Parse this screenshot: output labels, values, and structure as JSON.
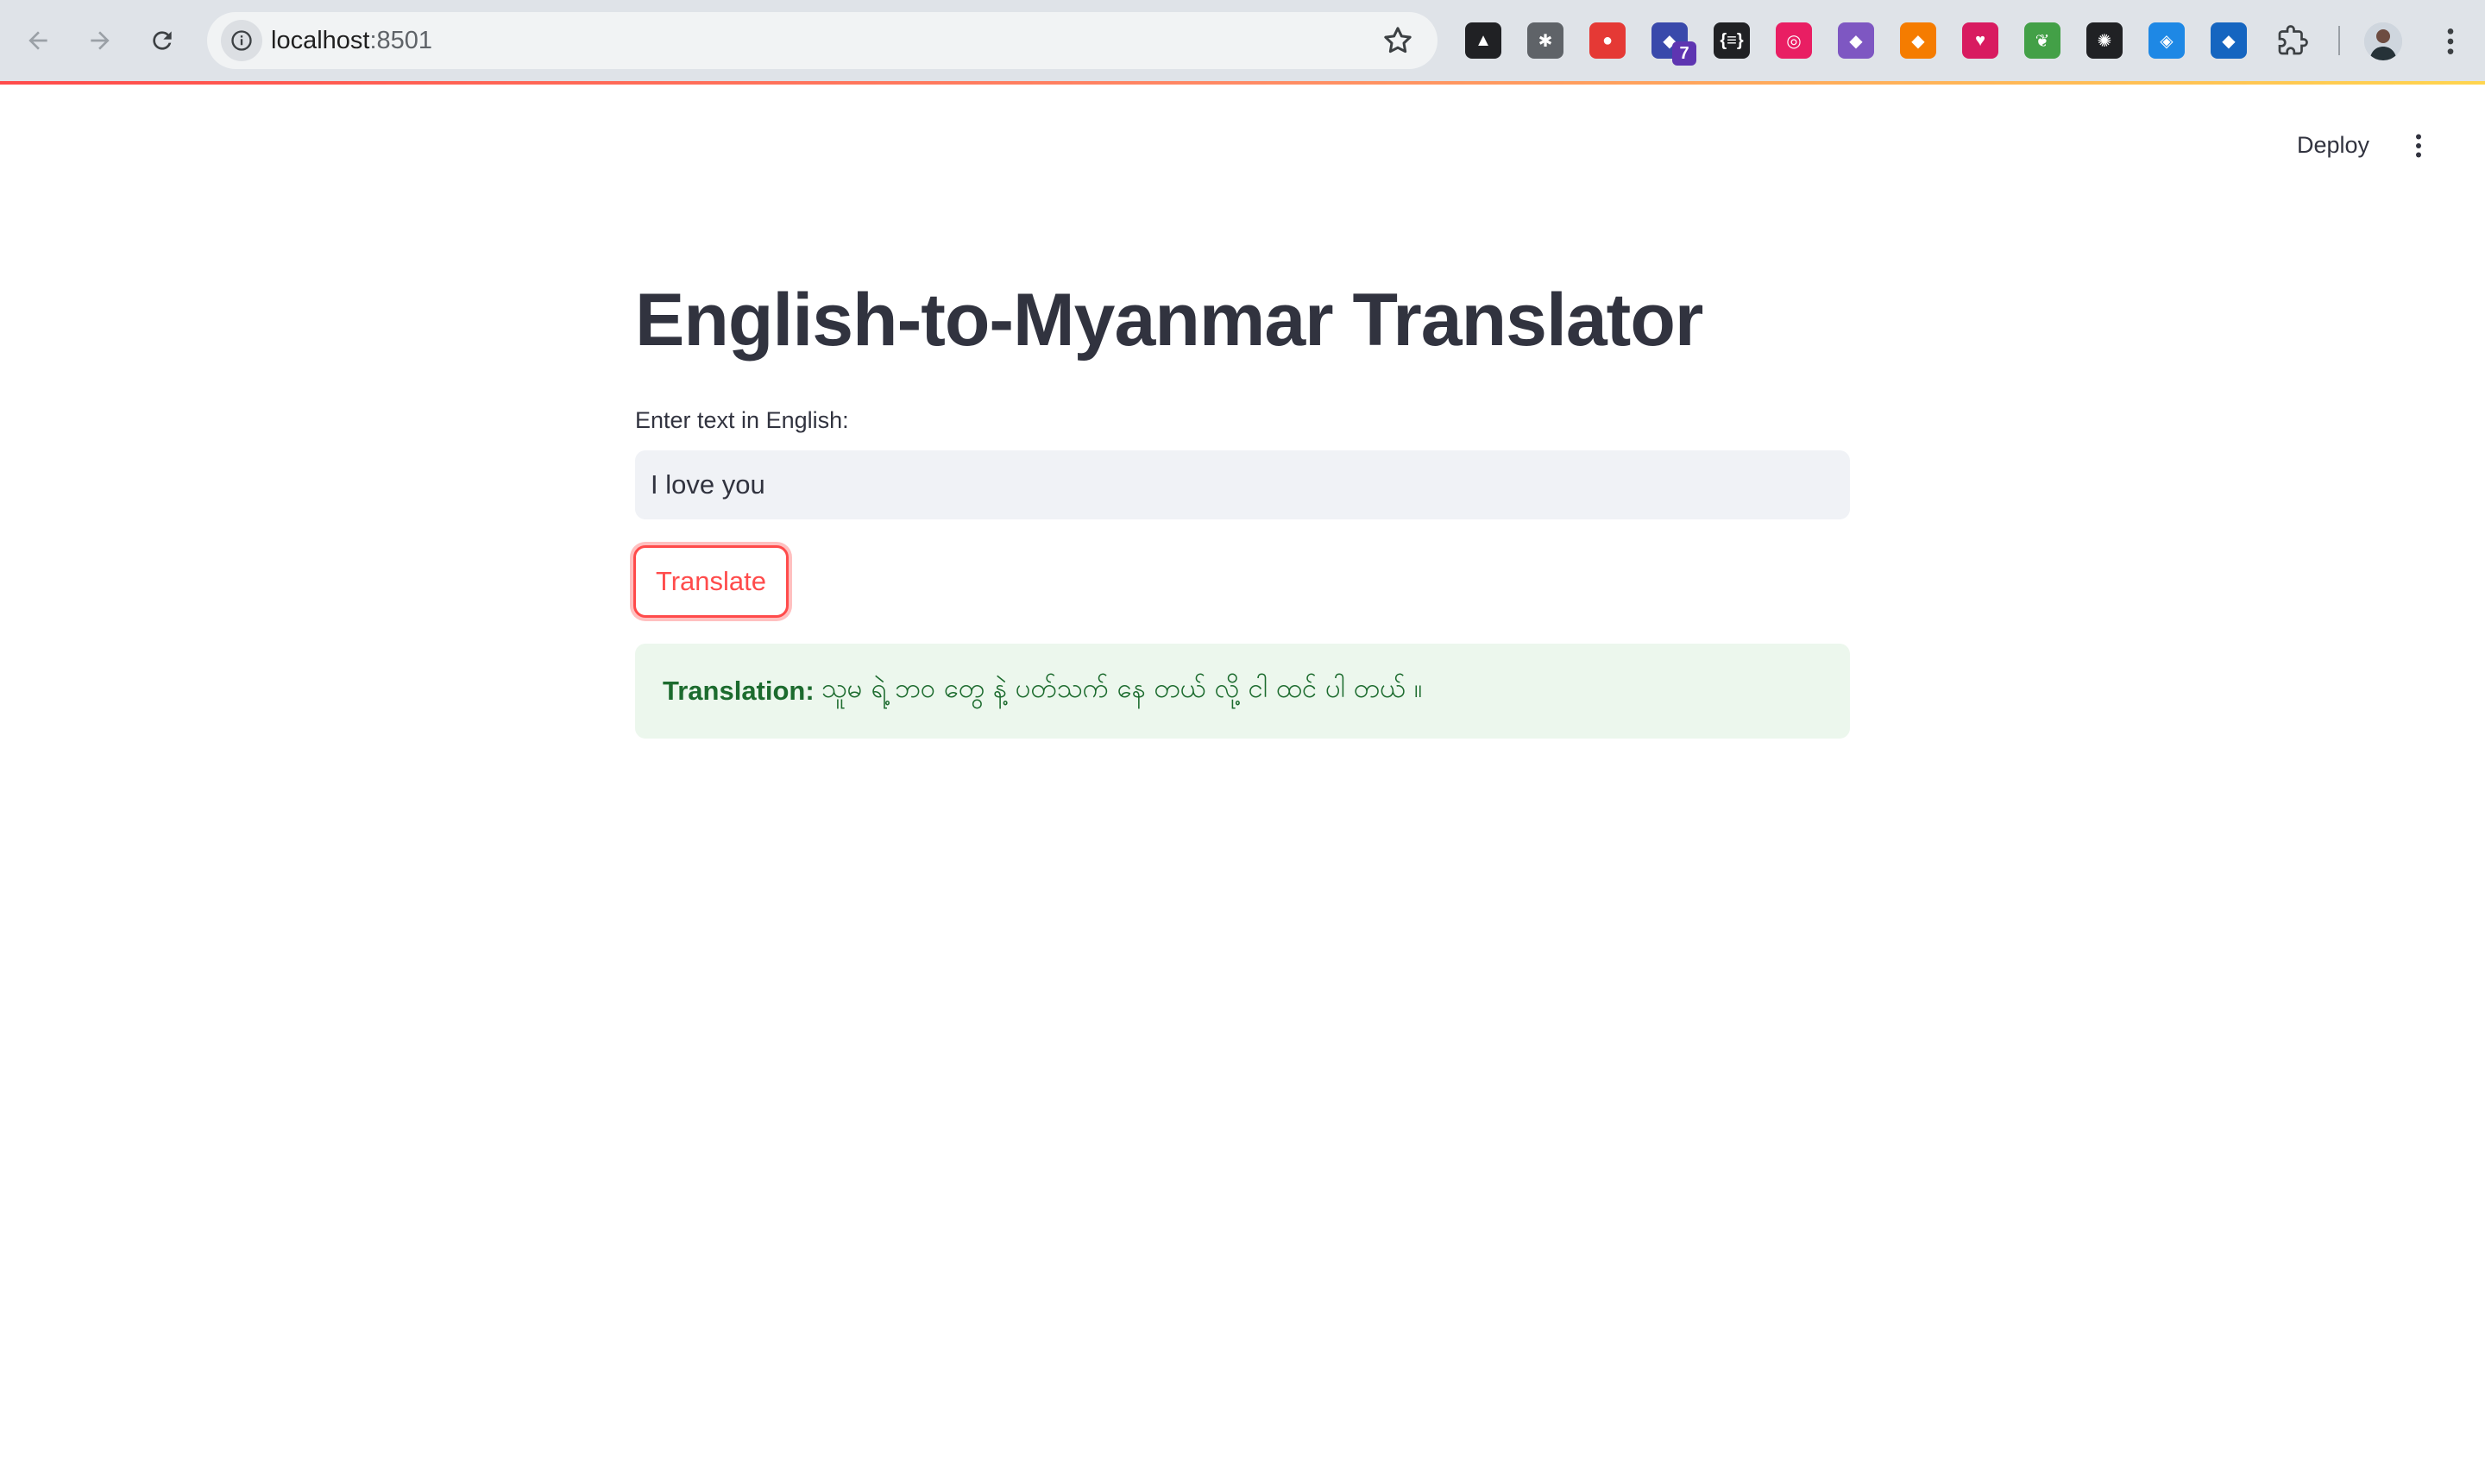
{
  "browser": {
    "url_host": "localhost",
    "url_port": ":8501",
    "icons": {
      "back": "arrow-left-icon",
      "forward": "arrow-right-icon",
      "reload": "reload-icon",
      "site_info": "info-icon",
      "bookmark": "star-icon",
      "extensions": "puzzle-icon",
      "menu": "kebab-icon"
    },
    "extensions": [
      {
        "name": "ext-anvil",
        "color": "#202124",
        "glyph": "▲"
      },
      {
        "name": "ext-bug",
        "color": "#5f6368",
        "glyph": "✱"
      },
      {
        "name": "ext-red",
        "color": "#e53935",
        "glyph": "●"
      },
      {
        "name": "ext-purple",
        "color": "#3949ab",
        "glyph": "◆",
        "badge": "7"
      },
      {
        "name": "ext-json",
        "color": "#202124",
        "glyph": "{≡}"
      },
      {
        "name": "ext-colorpicker",
        "color": "#e91e63",
        "glyph": "◎"
      },
      {
        "name": "ext-cat",
        "color": "#7e57c2",
        "glyph": "◆"
      },
      {
        "name": "ext-fox",
        "color": "#f57c00",
        "glyph": "◆"
      },
      {
        "name": "ext-heart",
        "color": "#d81b60",
        "glyph": "♥"
      },
      {
        "name": "ext-leaf",
        "color": "#43a047",
        "glyph": "❦"
      },
      {
        "name": "ext-openai",
        "color": "#202124",
        "glyph": "✺"
      },
      {
        "name": "ext-tag",
        "color": "#1e88e5",
        "glyph": "◈"
      },
      {
        "name": "ext-cap",
        "color": "#1565c0",
        "glyph": "◆"
      }
    ]
  },
  "header": {
    "deploy_label": "Deploy"
  },
  "main": {
    "title": "English-to-Myanmar Translator",
    "input_label": "Enter text in English:",
    "input_value": "I love you",
    "button_label": "Translate",
    "result_label": "Translation:",
    "result_text": "သူမ ရဲ့ ဘဝ တွေ နဲ့ ပတ်သက် နေ တယ် လို့ ငါ ထင် ပါ တယ် ။"
  },
  "colors": {
    "accent": "#ff4b4b",
    "success_bg": "#ecf7ed",
    "success_text": "#1c6b2e",
    "text": "#31333f"
  }
}
